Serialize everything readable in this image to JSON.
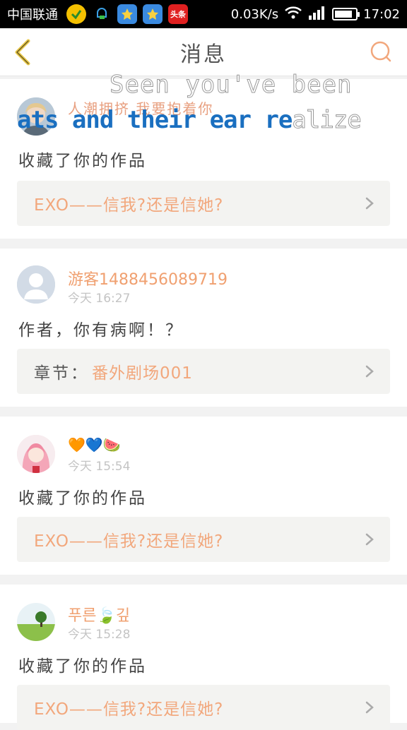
{
  "status_bar": {
    "carrier": "中国联通",
    "speed": "0.03K/s",
    "time": "17:02",
    "news_badge": "头条",
    "battery_level": 0.85
  },
  "header": {
    "title": "消息"
  },
  "overlay": {
    "line1": "Seen you've been",
    "line2_prefix": "ats and their ear re",
    "line2_suffix": "alize",
    "lyric": "人潮拥挤  我要抱着你"
  },
  "messages": [
    {
      "name": "",
      "time": "",
      "text": "收藏了你的作品",
      "link_prefix": "",
      "link": "EXO——信我?还是信她?"
    },
    {
      "name": "游客1488456089719",
      "time": "今天 16:27",
      "text": "作者，你有病啊！？",
      "link_prefix": "章节：",
      "link": "番外剧场001"
    },
    {
      "name": "🧡💙🍉",
      "time": "今天 15:54",
      "text": "收藏了你的作品",
      "link_prefix": "",
      "link": "EXO——信我?还是信她?"
    },
    {
      "name": "푸른🍃깊",
      "time": "今天 15:28",
      "text": "收藏了你的作品",
      "link_prefix": "",
      "link": "EXO——信我?还是信她?"
    }
  ],
  "colors": {
    "accent": "#f2a77c",
    "header_text": "#555555",
    "back_icon": "#e8c84a"
  }
}
